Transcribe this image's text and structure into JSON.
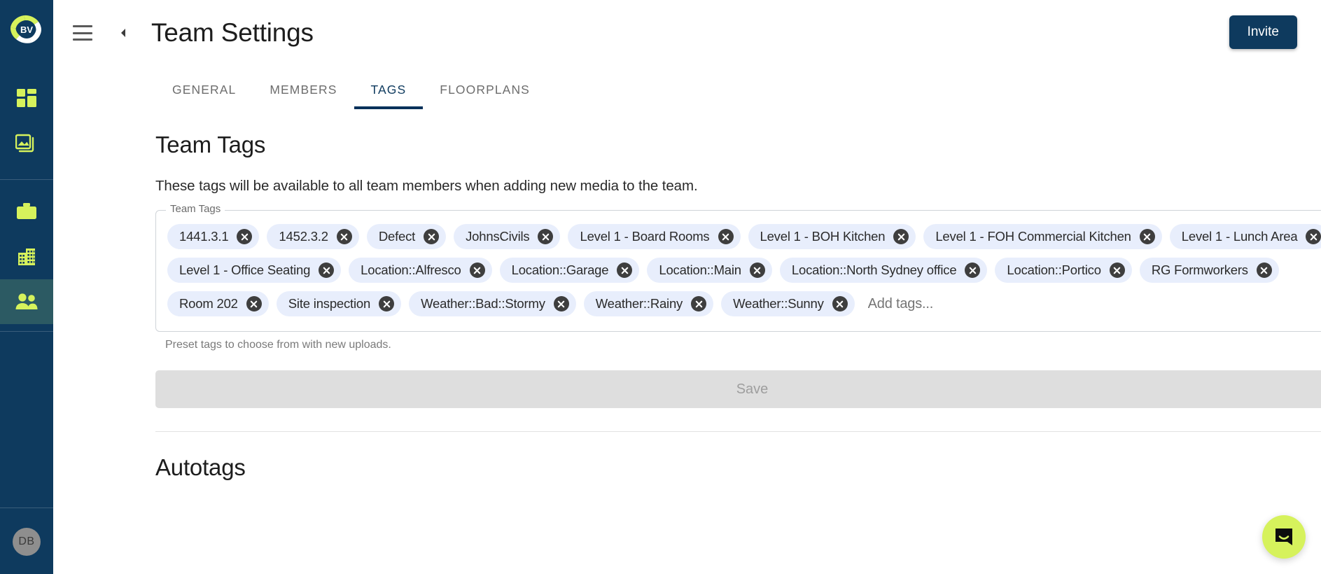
{
  "sidebar": {
    "logo": {
      "text": "BV",
      "name": "brand-logo"
    },
    "items": [
      {
        "icon": "dashboard-grid-icon",
        "name": "sidebar-item-dashboard",
        "active": false
      },
      {
        "icon": "media-gallery-icon",
        "name": "sidebar-item-media",
        "active": false
      },
      {
        "icon": "briefcase-icon",
        "name": "sidebar-item-projects",
        "active": false
      },
      {
        "icon": "building-icon",
        "name": "sidebar-item-company",
        "active": false
      },
      {
        "icon": "people-icon",
        "name": "sidebar-item-team",
        "active": true
      }
    ],
    "avatar": {
      "initials": "DB"
    }
  },
  "topbar": {
    "menu_icon": "hamburger-menu-icon",
    "back_icon": "chevron-left-icon",
    "title": "Team Settings",
    "invite_label": "Invite"
  },
  "tabs": [
    {
      "label": "GENERAL",
      "active": false
    },
    {
      "label": "MEMBERS",
      "active": false
    },
    {
      "label": "TAGS",
      "active": true
    },
    {
      "label": "FLOORPLANS",
      "active": false
    }
  ],
  "team_tags": {
    "heading": "Team Tags",
    "description": "These tags will be available to all team members when adding new media to the team.",
    "legend": "Team Tags",
    "placeholder": "Add tags...",
    "helper": "Preset tags to choose from with new uploads.",
    "save_label": "Save",
    "save_disabled": true,
    "chips": [
      "1441.3.1",
      "1452.3.2",
      "Defect",
      "JohnsCivils",
      "Level 1 - Board Rooms",
      "Level 1 - BOH Kitchen",
      "Level 1 - FOH Commercial Kitchen",
      "Level 1 - Lunch Area",
      "Level 1 - Office Seating",
      "Location::Alfresco",
      "Location::Garage",
      "Location::Main",
      "Location::North Sydney office",
      "Location::Portico",
      "RG Formworkers",
      "Room 202",
      "Site inspection",
      "Weather::Bad::Stormy",
      "Weather::Rainy",
      "Weather::Sunny"
    ]
  },
  "autotags": {
    "heading": "Autotags"
  },
  "chat": {
    "icon": "chat-bubble-smile-icon"
  },
  "colors": {
    "sidebar_bg": "#0e3a5e",
    "sidebar_active": "#2c5a63",
    "accent_lime": "#d6f25c",
    "chip_bg": "#e8eefc",
    "chip_close": "#3e3e3e",
    "tab_active": "#05315a",
    "invite_bg": "#0e3a5e",
    "save_bg": "#dedede"
  }
}
